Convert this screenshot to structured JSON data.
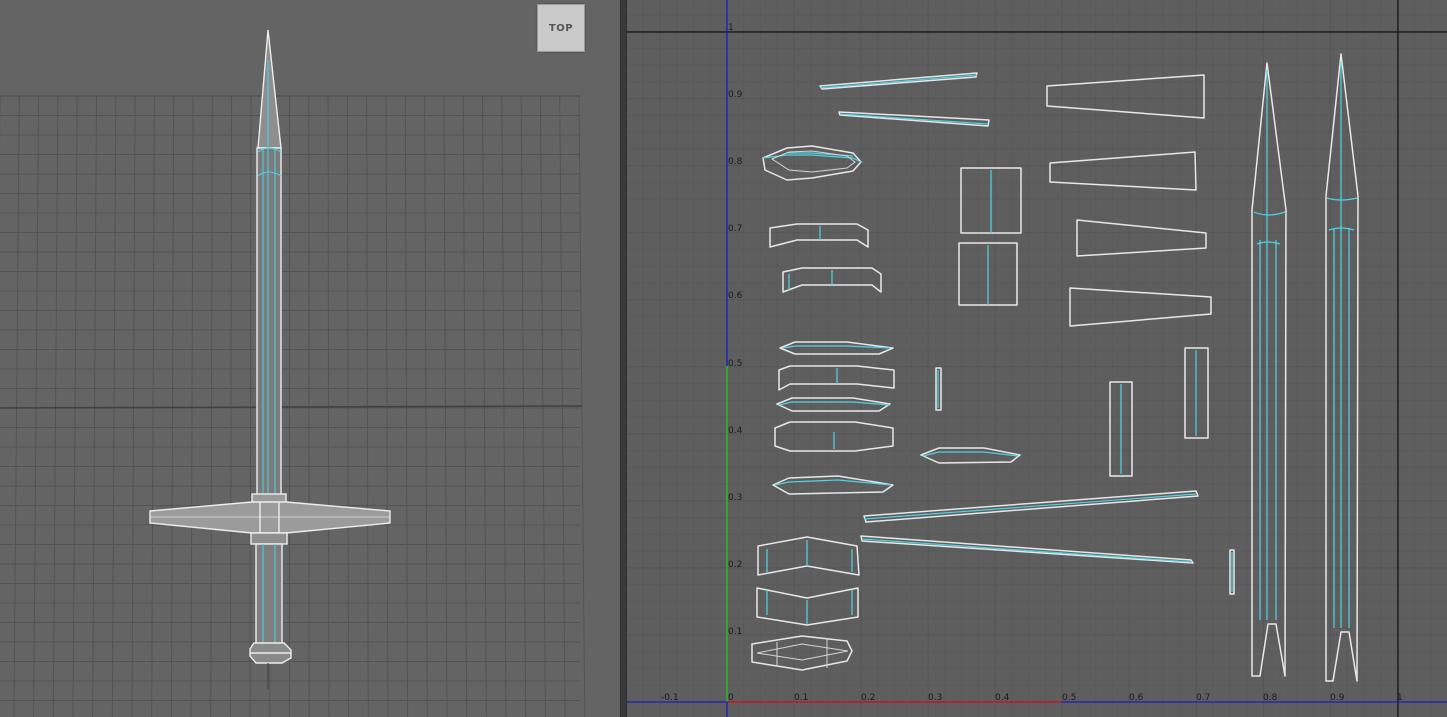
{
  "viewport": {
    "view_cube_label": "TOP"
  },
  "uv_editor": {
    "y_ticks": [
      "1",
      "0.9",
      "0.8",
      "0.7",
      "0.6",
      "0.5",
      "0.4",
      "0.3",
      "0.2",
      "0.1"
    ],
    "x_ticks": [
      "-0.1",
      "0",
      "0.1",
      "0.2",
      "0.3",
      "0.4",
      "0.5",
      "0.6",
      "0.7",
      "0.8",
      "0.9",
      "1"
    ]
  },
  "colors": {
    "viewport_bg": "#646464",
    "uv_bg": "#5e5e5e",
    "wire": "#e6e6e6",
    "uv_edge": "#4fd3e6",
    "v_axis": "#1a1acc",
    "u_axis_red": "#cc1a1a",
    "v_axis_green": "#1acc1a"
  }
}
